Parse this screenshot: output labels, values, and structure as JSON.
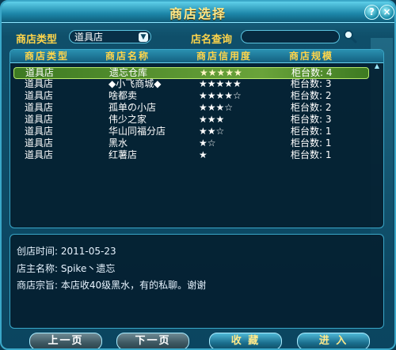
{
  "window": {
    "title": "商店选择",
    "help_icon_text": "?",
    "close_icon_text": "×"
  },
  "filters": {
    "shop_type_label": "商店类型",
    "shop_type_value": "道具店",
    "shop_search_label": "店名查询",
    "shop_search_value": ""
  },
  "table": {
    "headers": [
      "商店类型",
      "商店名称",
      "商店信用度",
      "商店规模"
    ],
    "rows": [
      {
        "type": "道具店",
        "name": "遗忘仓库",
        "credit": "★★★★★",
        "scale": "柜台数: 4",
        "selected": true
      },
      {
        "type": "道具店",
        "name": "◆小飞商城◆",
        "credit": "★★★★★",
        "scale": "柜台数: 3"
      },
      {
        "type": "道具店",
        "name": "啥都卖",
        "credit": "★★★★☆",
        "scale": "柜台数: 2"
      },
      {
        "type": "道具店",
        "name": "孤单の小店",
        "credit": "★★★☆",
        "scale": "柜台数: 2"
      },
      {
        "type": "道具店",
        "name": "伟少之家",
        "credit": "★★★",
        "scale": "柜台数: 3"
      },
      {
        "type": "道具店",
        "name": "华山同福分店",
        "credit": "★★☆",
        "scale": "柜台数: 1"
      },
      {
        "type": "道具店",
        "name": "黑水",
        "credit": "★☆",
        "scale": "柜台数: 1"
      },
      {
        "type": "道具店",
        "name": "红薯店",
        "credit": "★",
        "scale": "柜台数: 1"
      }
    ]
  },
  "info": {
    "open_time": "创店时间: 2011-05-23",
    "owner": "店主名称: Spike丶遗忘",
    "motto": "商店宗旨: 本店收40级黑水，有的私聊。谢谢"
  },
  "buttons": {
    "prev": "上一页",
    "next": "下一页",
    "favorite": "收 藏",
    "enter": "进 入"
  }
}
